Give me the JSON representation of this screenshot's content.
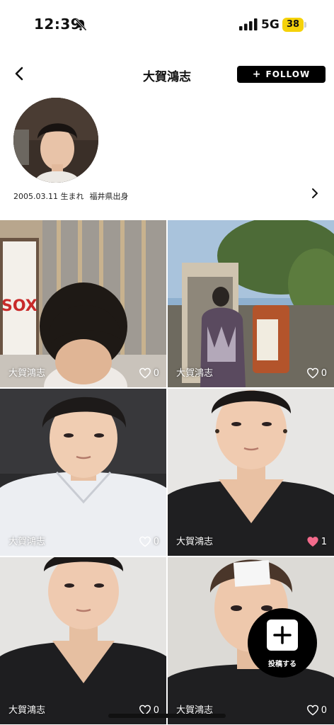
{
  "status_bar": {
    "time": "12:39",
    "network": "5G",
    "battery": "38"
  },
  "header": {
    "title": "大賀鴻志",
    "follow_label": "FOLLOW"
  },
  "profile": {
    "birth": "2005.03.11 生まれ",
    "origin": "福井県出身"
  },
  "posts": [
    {
      "author": "大賀鴻志",
      "likes": "0",
      "liked": false
    },
    {
      "author": "大賀鴻志",
      "likes": "0",
      "liked": false
    },
    {
      "author": "大賀鴻志",
      "likes": "0",
      "liked": false
    },
    {
      "author": "大賀鴻志",
      "likes": "1",
      "liked": true
    },
    {
      "author": "大賀鴻志",
      "likes": "0",
      "liked": false
    },
    {
      "author": "大賀鴻志",
      "likes": "0",
      "liked": false
    }
  ],
  "post_tile_text": "SOX",
  "fab": {
    "label": "投稿する"
  },
  "colors": {
    "battery": "#f5d20a",
    "liked_heart": "#f36b8c",
    "button_bg": "#000000"
  }
}
